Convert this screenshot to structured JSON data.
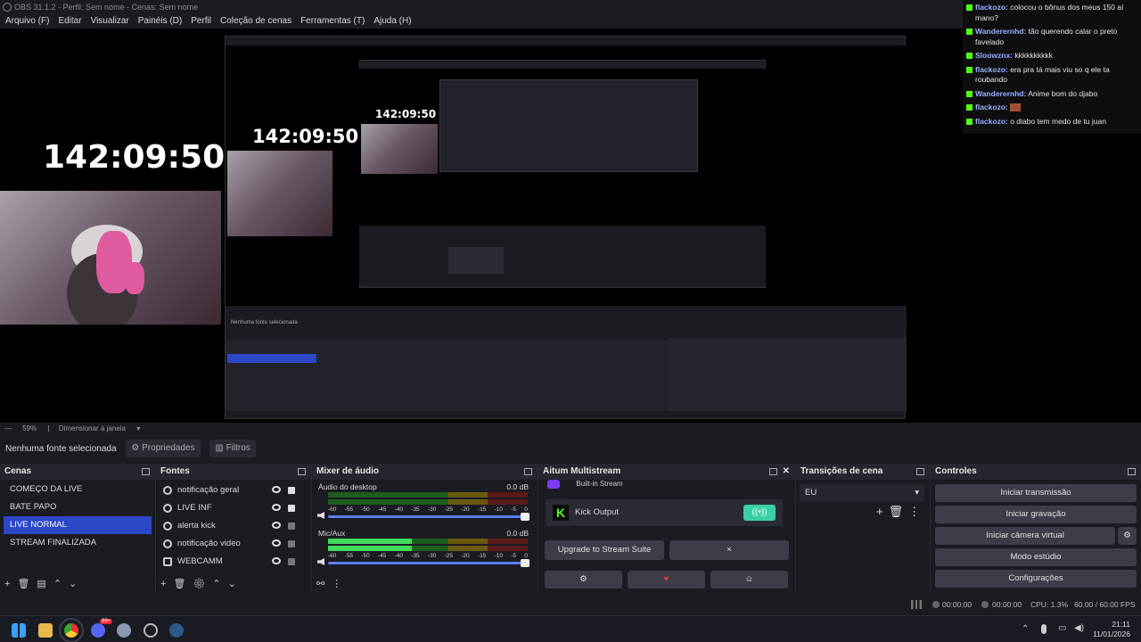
{
  "window": {
    "title": "OBS 31.1.2 - Perfil: Sem nome - Cenas: Sem nome"
  },
  "menu": [
    "Arquivo (F)",
    "Editar",
    "Visualizar",
    "Painéis (D)",
    "Perfil",
    "Coleção de cenas",
    "Ferramentas (T)",
    "Ajuda (H)"
  ],
  "preview": {
    "timer": "142:09:50"
  },
  "chat": [
    {
      "user": "flackozo:",
      "msg": "colocou o bônus dos meus 150 aí mano?"
    },
    {
      "user": "Wanderernhd:",
      "msg": "tão querendo calar o preto favelado"
    },
    {
      "user": "Sloowznx:",
      "msg": "kkkkkkkkkk"
    },
    {
      "user": "flackozo:",
      "msg": "era pra tá mais viu so q ele ta roubando"
    },
    {
      "user": "Wanderernhd:",
      "msg": "Anime bom do djabo"
    },
    {
      "user": "flackozo:",
      "msg": ""
    },
    {
      "user": "flackozo:",
      "msg": "o diabo tem medo de tu juan"
    }
  ],
  "zoom": {
    "level": "59%",
    "mode": "Dimensionar à janela"
  },
  "source_bar": {
    "no_source": "Nenhuma fonte selecionada",
    "properties": "Propriedades",
    "filters": "Filtros"
  },
  "scenes": {
    "title": "Cenas",
    "items": [
      "COMEÇO DA LIVE",
      "BATE PAPO",
      "LIVE NORMAL",
      "STREAM FINALIZADA"
    ],
    "selected_index": 2
  },
  "sources": {
    "title": "Fontes",
    "items": [
      {
        "label": "notificação geral",
        "locked": true
      },
      {
        "label": "LIVE INF",
        "locked": true
      },
      {
        "label": "alerta kick",
        "locked": false
      },
      {
        "label": "notificação video",
        "locked": false
      },
      {
        "label": "WEBCAMM",
        "locked": false
      }
    ]
  },
  "mixer": {
    "title": "Mixer de áudio",
    "channels": [
      {
        "name": "Áudio do desktop",
        "db": "0.0 dB",
        "level": 0.0
      },
      {
        "name": "Mic/Aux",
        "db": "0.0 dB",
        "level": 0.42
      }
    ],
    "scale": [
      "-60",
      "-55",
      "-50",
      "-45",
      "-40",
      "-35",
      "-30",
      "-25",
      "-20",
      "-15",
      "-10",
      "-5",
      "0"
    ]
  },
  "multistream": {
    "title": "Aitum Multistream",
    "output_top": "Built-in Stream",
    "output_name": "Kick Output",
    "upgrade": "Upgrade to Stream Suite",
    "close": "×"
  },
  "transitions": {
    "title": "Transições de cena",
    "value": "EU"
  },
  "controls": {
    "title": "Controles",
    "buttons": [
      "Iniciar transmissão",
      "Iniciar gravação",
      "Iniciar câmera virtual",
      "Modo estúdio",
      "Configurações"
    ]
  },
  "status": {
    "stream_time": "00:00:00",
    "rec_time": "00:00:00",
    "cpu": "CPU: 1.3%",
    "fps": "60.00 / 60.00 FPS"
  },
  "taskbar": {
    "time": "21:11",
    "date": "11/01/2026",
    "badge": "99+"
  }
}
